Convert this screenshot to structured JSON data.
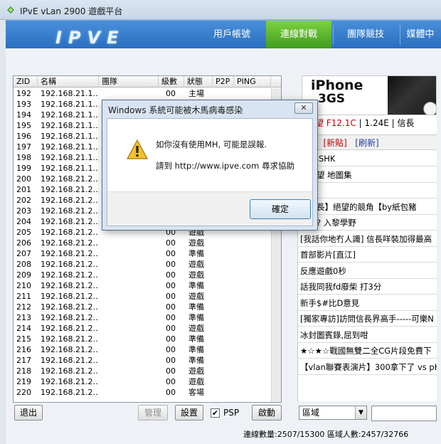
{
  "window": {
    "title": "IPvE vLan 2900 遊戲平台"
  },
  "banner": {
    "logo": "IPVE",
    "nav": [
      {
        "label": "用戶帳號"
      },
      {
        "label": "連線對戰"
      },
      {
        "label": "團隊競技"
      },
      {
        "label": "媒體中"
      }
    ]
  },
  "table": {
    "headers": [
      "ZID",
      "名稱",
      "團隊",
      "級數",
      "狀態",
      "P2P",
      "PING"
    ],
    "rows": [
      {
        "zid": "192",
        "name": "192.168.21.1...",
        "level": "00",
        "status": "主場"
      },
      {
        "zid": "193",
        "name": "192.168.21.1...",
        "level": "",
        "status": ""
      },
      {
        "zid": "194",
        "name": "192.168.21.1...",
        "level": "",
        "status": ""
      },
      {
        "zid": "195",
        "name": "192.168.21.1...",
        "level": "",
        "status": ""
      },
      {
        "zid": "196",
        "name": "192.168.21.1...",
        "level": "",
        "status": ""
      },
      {
        "zid": "197",
        "name": "192.168.21.1...",
        "level": "",
        "status": ""
      },
      {
        "zid": "198",
        "name": "192.168.21.1...",
        "level": "",
        "status": ""
      },
      {
        "zid": "199",
        "name": "192.168.21.1...",
        "level": "",
        "status": ""
      },
      {
        "zid": "200",
        "name": "192.168.21.2...",
        "level": "",
        "status": ""
      },
      {
        "zid": "201",
        "name": "192.168.21.2...",
        "level": "",
        "status": ""
      },
      {
        "zid": "202",
        "name": "192.168.21.2...",
        "level": "",
        "status": ""
      },
      {
        "zid": "203",
        "name": "192.168.21.2...",
        "level": "",
        "status": ""
      },
      {
        "zid": "204",
        "name": "192.168.21.2...",
        "level": "",
        "status": ""
      },
      {
        "zid": "205",
        "name": "192.168.21.2...",
        "level": "00",
        "status": "遊戲"
      },
      {
        "zid": "206",
        "name": "192.168.21.2...",
        "level": "00",
        "status": "遊戲"
      },
      {
        "zid": "207",
        "name": "192.168.21.2...",
        "level": "00",
        "status": "準備"
      },
      {
        "zid": "208",
        "name": "192.168.21.2...",
        "level": "00",
        "status": "遊戲"
      },
      {
        "zid": "209",
        "name": "192.168.21.2...",
        "level": "00",
        "status": "遊戲"
      },
      {
        "zid": "210",
        "name": "192.168.21.2...",
        "level": "00",
        "status": "準備"
      },
      {
        "zid": "211",
        "name": "192.168.21.2...",
        "level": "00",
        "status": "遊戲"
      },
      {
        "zid": "212",
        "name": "192.168.21.2...",
        "level": "00",
        "status": "準備"
      },
      {
        "zid": "213",
        "name": "192.168.21.2...",
        "level": "00",
        "status": "準備"
      },
      {
        "zid": "214",
        "name": "192.168.21.2...",
        "level": "00",
        "status": "遊戲"
      },
      {
        "zid": "215",
        "name": "192.168.21.2...",
        "level": "00",
        "status": "準備"
      },
      {
        "zid": "216",
        "name": "192.168.21.2...",
        "level": "00",
        "status": "準備"
      },
      {
        "zid": "217",
        "name": "192.168.21.2...",
        "level": "00",
        "status": "準備"
      },
      {
        "zid": "218",
        "name": "192.168.21.2...",
        "level": "00",
        "status": "遊戲"
      },
      {
        "zid": "219",
        "name": "192.168.21.2...",
        "level": "00",
        "status": "遊戲"
      },
      {
        "zid": "220",
        "name": "192.168.21.2...",
        "level": "00",
        "status": "客場"
      }
    ]
  },
  "buttons": {
    "exit": "退出",
    "manage": "管理",
    "settings": "設置",
    "psp_checked": "✔",
    "psp_label": "PSP",
    "start": "啟動"
  },
  "ad": {
    "title": "iPhone",
    "subtitle": "3GS"
  },
  "news": {
    "header_red": "之野望 F12.1C",
    "header_rest": " | 1.24E | 信長",
    "tab_topic": "話題",
    "tab_new": "[新貼]",
    "tab_refresh": "[刷新]",
    "items": [
      "AF與SHK",
      "之野望 地圖集",
      "故事",
      "田信長】絕望的競角【by紙包豬",
      "舒服? 入黎學野",
      "[我話你地冇人識] 信長咩裝加得最高",
      "首部影片[直江]",
      "反應遊戲0秒",
      "話我同我fd廢柴 打3分",
      "新手$#比D意見",
      "[獨家專訪]訪問信長界高手-----可樂N",
      "冰封圖賓錄,屈到咁",
      "★☆★☆戰國無雙二全CG片段免費下",
      "【vlan聯賽表演片】300拿下了 vs pH"
    ]
  },
  "region": {
    "value": "區域",
    "arrow": "▼"
  },
  "status": {
    "text": "連線數量:2507/15300   區域人數:2457/32766"
  },
  "dialog": {
    "title": "Windows 系統可能被木馬病毒感染",
    "close": "✕",
    "line1": "如你沒有使用MH, 可能是誤報.",
    "line2": "請到 http://www.ipve.com 尋求協助",
    "ok": "確定"
  },
  "colors": {
    "nav_active": "#5cb82c",
    "banner": "#2f74c6",
    "news_red": "#c00000"
  }
}
